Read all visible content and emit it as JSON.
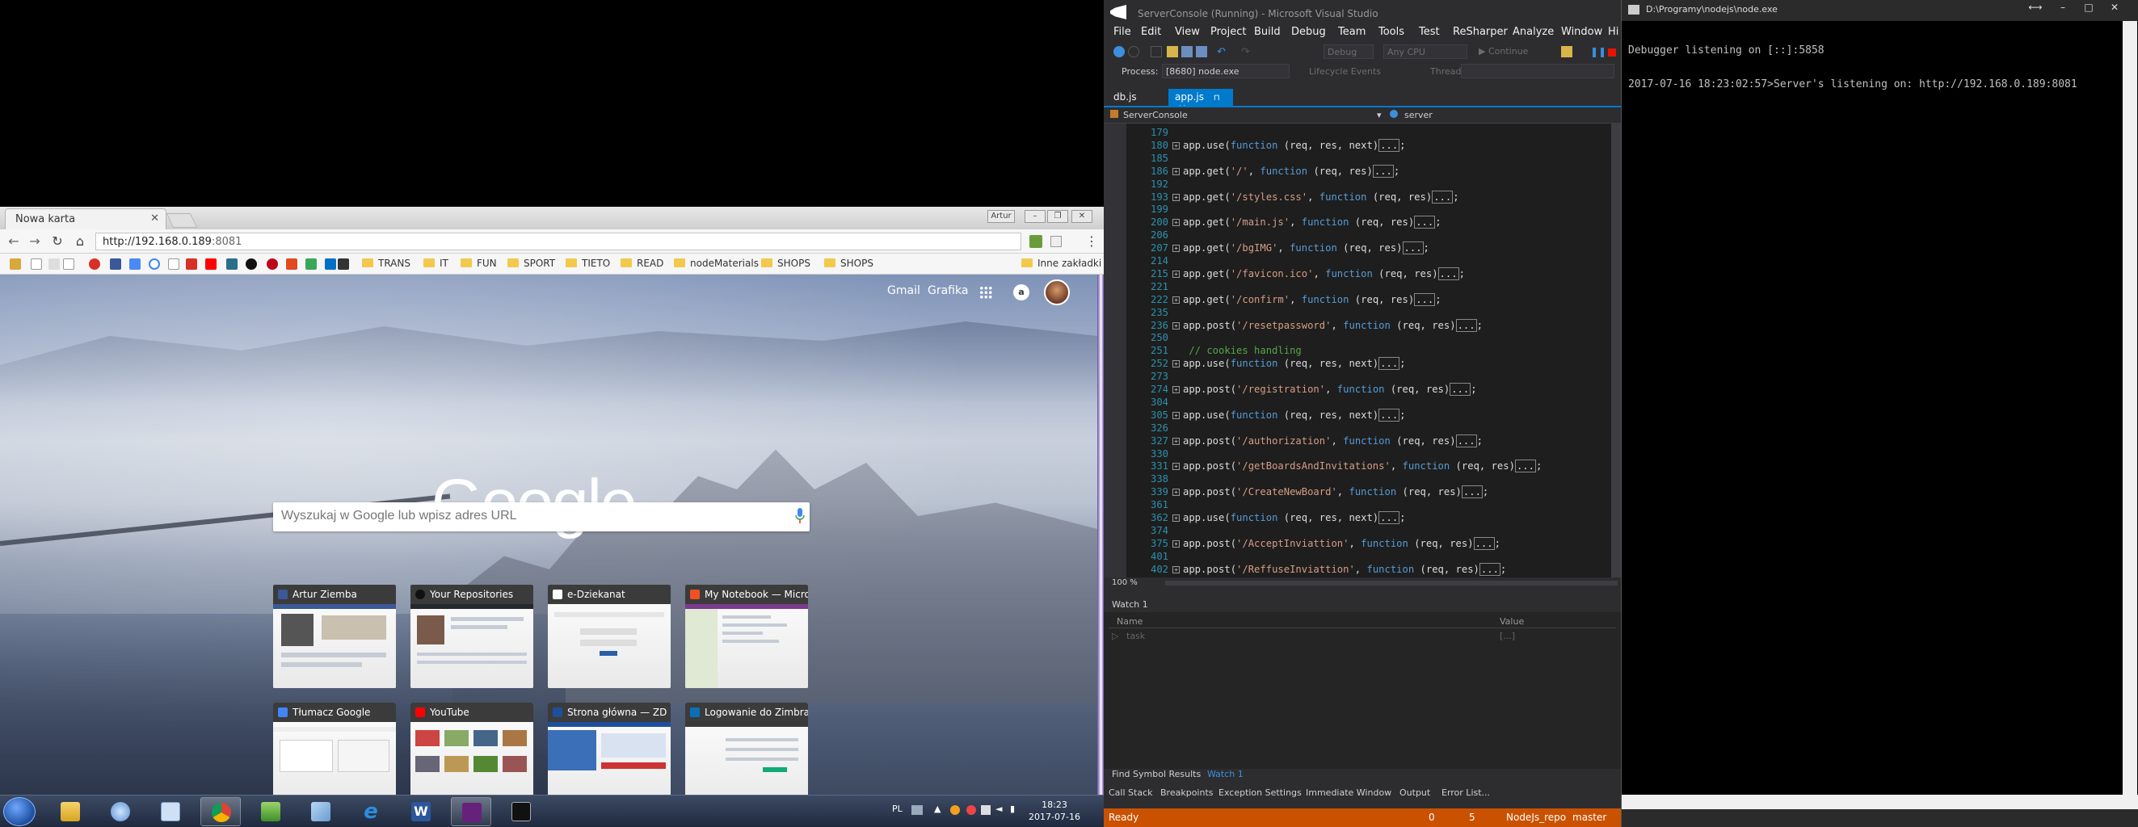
{
  "chrome": {
    "tab_title": "Nowa karta",
    "address_host": "http://192.168.0.189",
    "address_port": ":8081",
    "bookmarks": [
      "TRANS",
      "IT",
      "FUN",
      "SPORT",
      "TIETO",
      "READ",
      "nodeMaterials",
      "SHOPS",
      "SHOPS"
    ],
    "other_bookmarks": "Inne zakładki",
    "gmail": "Gmail",
    "images": "Grafika",
    "logo": "Google",
    "search_placeholder": "Wyszukaj w Google lub wpisz adres URL",
    "most_visited": [
      {
        "title": "Artur Ziemba",
        "color": "#3b5998"
      },
      {
        "title": "Your Repositories",
        "color": "#333333"
      },
      {
        "title": "e-Dziekanat",
        "color": "#ffffff"
      },
      {
        "title": "My Notebook — Micro",
        "color": "#f25022"
      },
      {
        "title": "Tłumacz Google",
        "color": "#4285f4"
      },
      {
        "title": "YouTube",
        "color": "#ff0000"
      },
      {
        "title": "Strona główna — ZD",
        "color": "#1d4f9c"
      },
      {
        "title": "Logowanie do Zimbra",
        "color": "#0b6fb6"
      }
    ]
  },
  "taskbar": {
    "lang": "PL",
    "time": "18:23",
    "date": "2017-07-16"
  },
  "vs": {
    "title": "ServerConsole (Running) - Microsoft Visual Studio",
    "menu": [
      "File",
      "Edit",
      "View",
      "Project",
      "Build",
      "Debug",
      "Team",
      "Tools",
      "Test",
      "ReSharper",
      "Analyze",
      "Window",
      "Hi"
    ],
    "config": "Debug",
    "platform": "Any CPU",
    "continue": "Continue",
    "process_label": "Process:",
    "process_value": "[8680] node.exe",
    "lifecycle": "Lifecycle Events",
    "thread": "Thread:",
    "tabs": [
      "db.js",
      "app.js"
    ],
    "nav_left": "ServerConsole",
    "nav_right": "server",
    "zoom": "100 %",
    "code": [
      {
        "n": "179",
        "t": ""
      },
      {
        "n": "180",
        "t": "app.use(function (req, res, next)[...];",
        "f": true
      },
      {
        "n": "185",
        "t": ""
      },
      {
        "n": "186",
        "t": "app.get('/', function (req, res)[...];",
        "f": true
      },
      {
        "n": "192",
        "t": ""
      },
      {
        "n": "193",
        "t": "app.get('/styles.css', function (req, res)[...];",
        "f": true
      },
      {
        "n": "199",
        "t": ""
      },
      {
        "n": "200",
        "t": "app.get('/main.js', function (req, res)[...];",
        "f": true
      },
      {
        "n": "206",
        "t": ""
      },
      {
        "n": "207",
        "t": "app.get('/bgIMG', function (req, res)[...];",
        "f": true
      },
      {
        "n": "214",
        "t": ""
      },
      {
        "n": "215",
        "t": "app.get('/favicon.ico', function (req, res)[...];",
        "f": true
      },
      {
        "n": "221",
        "t": ""
      },
      {
        "n": "222",
        "t": "app.get('/confirm', function (req, res)[...];",
        "f": true
      },
      {
        "n": "235",
        "t": ""
      },
      {
        "n": "236",
        "t": "app.post('/resetpassword', function (req, res)[...];",
        "f": true
      },
      {
        "n": "250",
        "t": ""
      },
      {
        "n": "251",
        "t": " // cookies handling",
        "c": true
      },
      {
        "n": "252",
        "t": "app.use(function (req, res, next)[...];",
        "f": true
      },
      {
        "n": "273",
        "t": ""
      },
      {
        "n": "274",
        "t": "app.post('/registration', function (req, res)[...];",
        "f": true
      },
      {
        "n": "304",
        "t": ""
      },
      {
        "n": "305",
        "t": "app.use(function (req, res, next)[...];",
        "f": true
      },
      {
        "n": "326",
        "t": ""
      },
      {
        "n": "327",
        "t": "app.post('/authorization', function (req, res)[...];",
        "f": true
      },
      {
        "n": "330",
        "t": ""
      },
      {
        "n": "331",
        "t": "app.post('/getBoardsAndInvitations', function (req, res)[...];",
        "f": true
      },
      {
        "n": "338",
        "t": ""
      },
      {
        "n": "339",
        "t": "app.post('/CreateNewBoard', function (req, res)[...];",
        "f": true
      },
      {
        "n": "361",
        "t": ""
      },
      {
        "n": "362",
        "t": "app.use(function (req, res, next)[...];",
        "f": true
      },
      {
        "n": "374",
        "t": ""
      },
      {
        "n": "375",
        "t": "app.post('/AcceptInviattion', function (req, res)[...];",
        "f": true
      },
      {
        "n": "401",
        "t": ""
      },
      {
        "n": "402",
        "t": "app.post('/ReffuseInviattion', function (req, res)[...];",
        "f": true
      }
    ],
    "watch_title": "Watch 1",
    "watch_name": "Name",
    "watch_value": "Value",
    "watch_row_name": "task",
    "watch_row_value": "[...]",
    "bottom_tabs1": [
      "Find Symbol Results",
      "Watch 1"
    ],
    "bottom_tabs2": [
      "Call Stack",
      "Breakpoints",
      "Exception Settings",
      "Immediate Window",
      "Output",
      "Error List..."
    ],
    "status": "Ready",
    "status_right": [
      "0",
      "5",
      "NodeJs_repo",
      "master"
    ]
  },
  "console": {
    "title": "D:\\Programy\\nodejs\\node.exe",
    "lines": [
      "Debugger listening on [::]:5858",
      "2017-07-16 18:23:02:57>Server's listening on: http://192.168.0.189:8081"
    ]
  }
}
